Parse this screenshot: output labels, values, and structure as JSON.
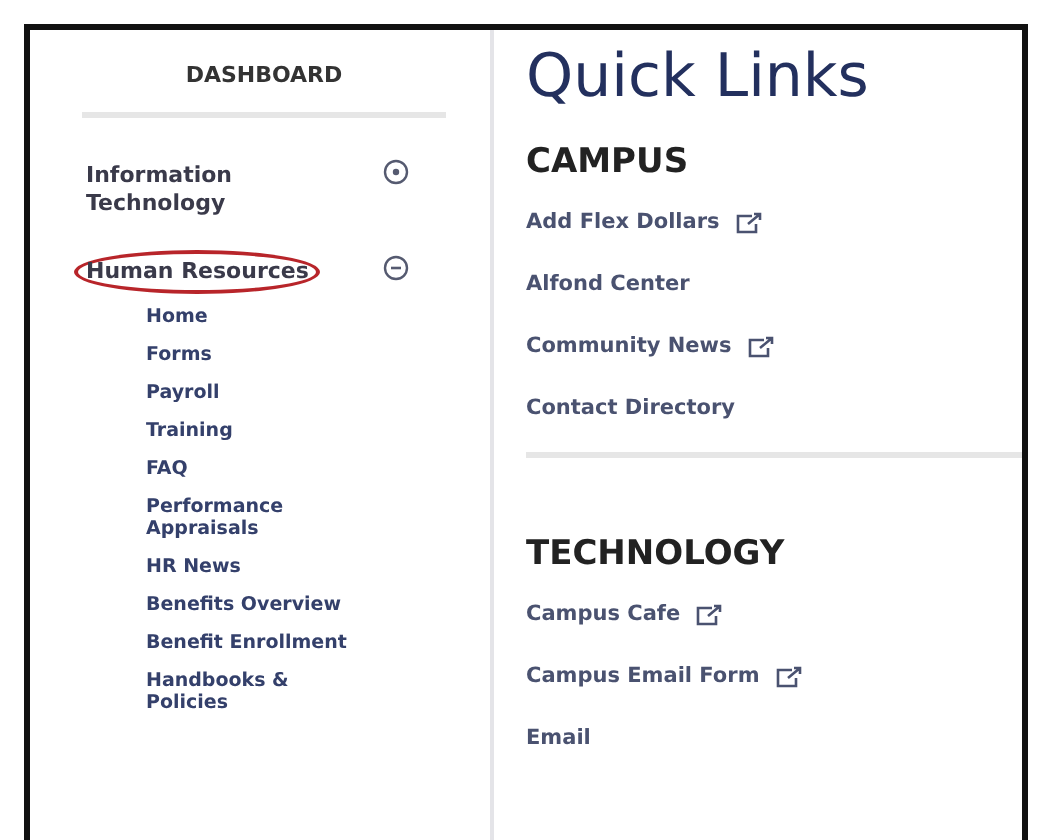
{
  "sidebar": {
    "title": "DASHBOARD",
    "items": [
      {
        "label": "Information Technology",
        "expanded": false,
        "circled": false
      },
      {
        "label": "Human Resources",
        "expanded": true,
        "circled": true,
        "children": [
          {
            "label": "Home"
          },
          {
            "label": "Forms"
          },
          {
            "label": "Payroll"
          },
          {
            "label": "Training"
          },
          {
            "label": "FAQ"
          },
          {
            "label": "Performance Appraisals"
          },
          {
            "label": "HR News"
          },
          {
            "label": "Benefits Overview"
          },
          {
            "label": "Benefit Enrollment"
          },
          {
            "label": "Handbooks & Policies"
          }
        ]
      }
    ]
  },
  "main": {
    "title": "Quick Links",
    "sections": [
      {
        "heading": "CAMPUS",
        "links": [
          {
            "label": "Add Flex Dollars",
            "external": true
          },
          {
            "label": "Alfond Center",
            "external": false
          },
          {
            "label": "Community News",
            "external": true
          },
          {
            "label": "Contact Directory",
            "external": false
          }
        ]
      },
      {
        "heading": "TECHNOLOGY",
        "links": [
          {
            "label": "Campus Cafe",
            "external": true
          },
          {
            "label": "Campus Email Form",
            "external": true
          },
          {
            "label": "Email",
            "external": false
          }
        ]
      }
    ]
  }
}
